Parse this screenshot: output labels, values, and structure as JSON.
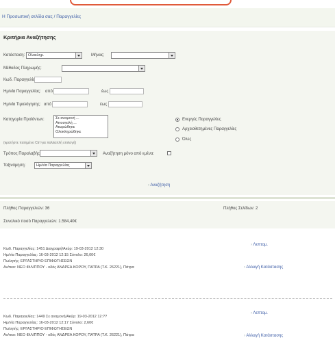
{
  "breadcrumb": "Η Προσωπική σελίδα σας / Παραγγελίες",
  "search": {
    "title": "Κριτήρια Αναζήτησης",
    "status_label": "Κατάσταση:",
    "status_value": "Ολοκληρ.",
    "month_label": "Μήνας:",
    "month_value": "",
    "method_label": "Μέθοδος Πληρωμής:",
    "method_value": "",
    "code_label": "Κωδ. Παραγγελίας:",
    "date_order_label": "Ημ/νία Παραγγελίας:",
    "date_order_from": "από",
    "date_order_to": "έως",
    "date_invoice_label": "Ημ/νία Τιμολόγησης:",
    "date_invoice_from": "από",
    "date_invoice_to": "έως",
    "products_label": "Κατηγορία Προϊόντων:",
    "products_options": [
      "Σε αναμονή ...",
      "Αποστολή ...",
      "Ακυρώθηκε",
      "Ολοκληρώθηκε"
    ],
    "hint": "(κρατήστε πατημένο Ctrl για πολλαπλή επιλογή)",
    "store_label": "Τρόπος Παραλαβής:",
    "store_value": "",
    "only_label": "Αναζήτηση μόνο από εμένα:",
    "sort_label": "Ταξινόμηση:",
    "sort_value": "Ημ/νία Παραγγελίας",
    "radios": [
      {
        "label": "Ενεργές Παραγγελίες",
        "checked": true
      },
      {
        "label": "Αρχειοθετημένες Παραγγελίες",
        "checked": false
      },
      {
        "label": "Όλες",
        "checked": false
      }
    ],
    "button": "Αναζήτηση"
  },
  "summary": {
    "total_orders": "Πλήθος Παραγγελιών: 36",
    "total_pages": "Πλήθος Σελίδων: 2",
    "total_amount": "Συνολικό ποσό Παραγγελιών: 1.584,40€"
  },
  "orders": [
    {
      "line1": "Κωδ. Παραγγελίας: 1451     Διαγραφή/Ακύρ: 19-03-2012 12:30",
      "line2": "Ημ/νία Παραγγελίας: 16-03-2012 12:15     Σύνολο: 26,00€",
      "line3": "Πωλητής: ΕΡΓΑΣΤΗΡΙΟ ΕΠΙΦΩΤΗΣΕΩΝ",
      "line4": "Αν/τικο: ΝΕΟ ΦΙΛΙΠΠΟΥ - οδός ΑΝΔΡΕΑ ΚΟΡΟΥ, ΠΑΤΡΑ (Τ.Κ. 26221), Πάτρα",
      "action1": "Λεπτομ.",
      "action2": "Αλλαγή Κατάστασης"
    },
    {
      "line1": "Κωδ. Παραγγελίας: 1449     Σε αναμονή/Ακύρ: 19-03-2012 12:??",
      "line2": "Ημ/νία Παραγγελίας: 16-03-2012 12:17     Σύνολο: 2,60€",
      "line3": "Πωλητής: ΕΡΓΑΣΤΗΡΙΟ ΕΠΙΦΩΤΗΣΕΩΝ",
      "line4": "Αν/τικο: ΝΕΟ ΦΙΛΙΠΠΟΥ - οδός ΑΝΔΡΕΑ ΚΟΡΟΥ, ΠΑΤΡΑ (Τ.Κ. 26221), Πάτρα",
      "action1": "Λεπτομ.",
      "action2": "Αλλαγή Κατάστασης"
    }
  ]
}
